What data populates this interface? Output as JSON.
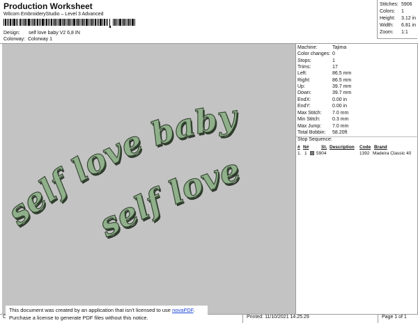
{
  "header": {
    "title": "Production Worksheet",
    "subtitle": "Wilcom EmbroideryStudio – Level 3 Advanced",
    "design_label": "Design:",
    "design_value": "self love baby V2 6,8 IN",
    "colorway_label": "Colorway:",
    "colorway_value": "Colorway 1"
  },
  "info": {
    "stitches_label": "Stitches:",
    "stitches_value": "5906",
    "colors_label": "Colors:",
    "colors_value": "1",
    "height_label": "Height:",
    "height_value": "3.12 in",
    "width_label": "Width:",
    "width_value": "6.81 in",
    "zoom_label": "Zoom:",
    "zoom_value": "1:1"
  },
  "stats": {
    "machine_label": "Machine:",
    "machine_value": "Tajima",
    "color_changes_label": "Color changes:",
    "color_changes_value": "0",
    "stops_label": "Stops:",
    "stops_value": "1",
    "trims_label": "Trims:",
    "trims_value": "17",
    "left_label": "Left:",
    "left_value": "86.5 mm",
    "right_label": "Right:",
    "right_value": "86.5 mm",
    "up_label": "Up:",
    "up_value": "39.7 mm",
    "down_label": "Down:",
    "down_value": "39.7 mm",
    "endx_label": "EndX:",
    "endx_value": "0.00 in",
    "endy_label": "EndY:",
    "endy_value": "0.00 in",
    "max_stitch_label": "Max Stitch:",
    "max_stitch_value": "7.0 mm",
    "min_stitch_label": "Min Stitch:",
    "min_stitch_value": "0.3 mm",
    "max_jump_label": "Max Jump:",
    "max_jump_value": "7.0 mm",
    "total_bobbin_label": "Total Bobbin:",
    "total_bobbin_value": "58.20ft"
  },
  "sequence": {
    "title": "Stop Sequence:",
    "headers": {
      "num": "#",
      "n": "N#",
      "st": "St.",
      "description": "Description",
      "code": "Code",
      "brand": "Brand"
    },
    "row": {
      "num": "1.",
      "n": "1",
      "st": "5904",
      "description": "",
      "code": "1392",
      "brand": "Madeira Classic 40"
    },
    "swatch_color": "#7a7a7a"
  },
  "design": {
    "line1": "self love baby",
    "line2": "self love",
    "thread_color": "#8fb08a",
    "background_color": "#c3c3c3"
  },
  "notice": {
    "text1": "This document was created by an application that isn't licensed to use ",
    "link": "novaPDF",
    "text1_end": ".",
    "text2": "Purchase a license to generate PDF files without this notice."
  },
  "footer": {
    "left": "Cr",
    "printed": "Printed: 11/10/2021 14.25.29",
    "page": "Page 1 of 1"
  }
}
